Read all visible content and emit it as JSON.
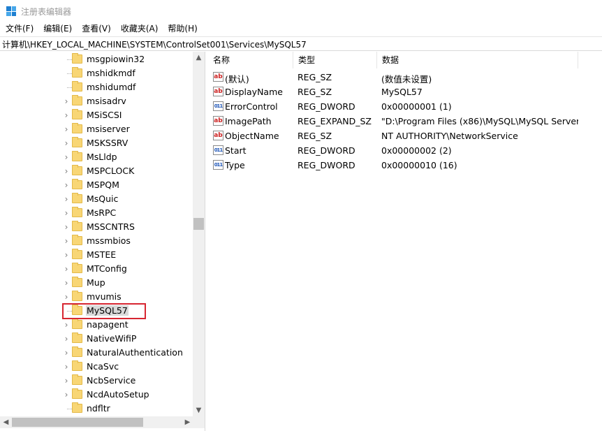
{
  "window": {
    "title": "注册表编辑器"
  },
  "menu": [
    "文件(F)",
    "编辑(E)",
    "查看(V)",
    "收藏夹(A)",
    "帮助(H)"
  ],
  "address": "计算机\\HKEY_LOCAL_MACHINE\\SYSTEM\\ControlSet001\\Services\\MySQL57",
  "tree": {
    "items": [
      {
        "label": "msgpiowin32",
        "expandable": false
      },
      {
        "label": "mshidkmdf",
        "expandable": false
      },
      {
        "label": "mshidumdf",
        "expandable": false
      },
      {
        "label": "msisadrv",
        "expandable": true
      },
      {
        "label": "MSiSCSI",
        "expandable": true
      },
      {
        "label": "msiserver",
        "expandable": true
      },
      {
        "label": "MSKSSRV",
        "expandable": true
      },
      {
        "label": "MsLldp",
        "expandable": true
      },
      {
        "label": "MSPCLOCK",
        "expandable": true
      },
      {
        "label": "MSPQM",
        "expandable": true
      },
      {
        "label": "MsQuic",
        "expandable": true
      },
      {
        "label": "MsRPC",
        "expandable": true
      },
      {
        "label": "MSSCNTRS",
        "expandable": true
      },
      {
        "label": "mssmbios",
        "expandable": true
      },
      {
        "label": "MSTEE",
        "expandable": true
      },
      {
        "label": "MTConfig",
        "expandable": true
      },
      {
        "label": "Mup",
        "expandable": true
      },
      {
        "label": "mvumis",
        "expandable": true
      },
      {
        "label": "MySQL57",
        "expandable": false,
        "selected": true
      },
      {
        "label": "napagent",
        "expandable": true
      },
      {
        "label": "NativeWifiP",
        "expandable": true
      },
      {
        "label": "NaturalAuthentication",
        "expandable": true
      },
      {
        "label": "NcaSvc",
        "expandable": true
      },
      {
        "label": "NcbService",
        "expandable": true
      },
      {
        "label": "NcdAutoSetup",
        "expandable": true
      },
      {
        "label": "ndfltr",
        "expandable": false
      }
    ]
  },
  "values": {
    "headers": {
      "name": "名称",
      "type": "类型",
      "data": "数据"
    },
    "rows": [
      {
        "icon": "string-value-icon",
        "name": "(默认)",
        "type": "REG_SZ",
        "data": "(数值未设置)"
      },
      {
        "icon": "string-value-icon",
        "name": "DisplayName",
        "type": "REG_SZ",
        "data": "MySQL57"
      },
      {
        "icon": "dword-value-icon",
        "name": "ErrorControl",
        "type": "REG_DWORD",
        "data": "0x00000001 (1)"
      },
      {
        "icon": "string-value-icon",
        "name": "ImagePath",
        "type": "REG_EXPAND_SZ",
        "data": "\"D:\\Program Files (x86)\\MySQL\\MySQL Server..."
      },
      {
        "icon": "string-value-icon",
        "name": "ObjectName",
        "type": "REG_SZ",
        "data": "NT AUTHORITY\\NetworkService"
      },
      {
        "icon": "dword-value-icon",
        "name": "Start",
        "type": "REG_DWORD",
        "data": "0x00000002 (2)"
      },
      {
        "icon": "dword-value-icon",
        "name": "Type",
        "type": "REG_DWORD",
        "data": "0x00000010 (16)"
      }
    ]
  },
  "colors": {
    "highlight_box": "#d72631",
    "folder": "#f8d675",
    "selection": "#d9d9d9"
  }
}
